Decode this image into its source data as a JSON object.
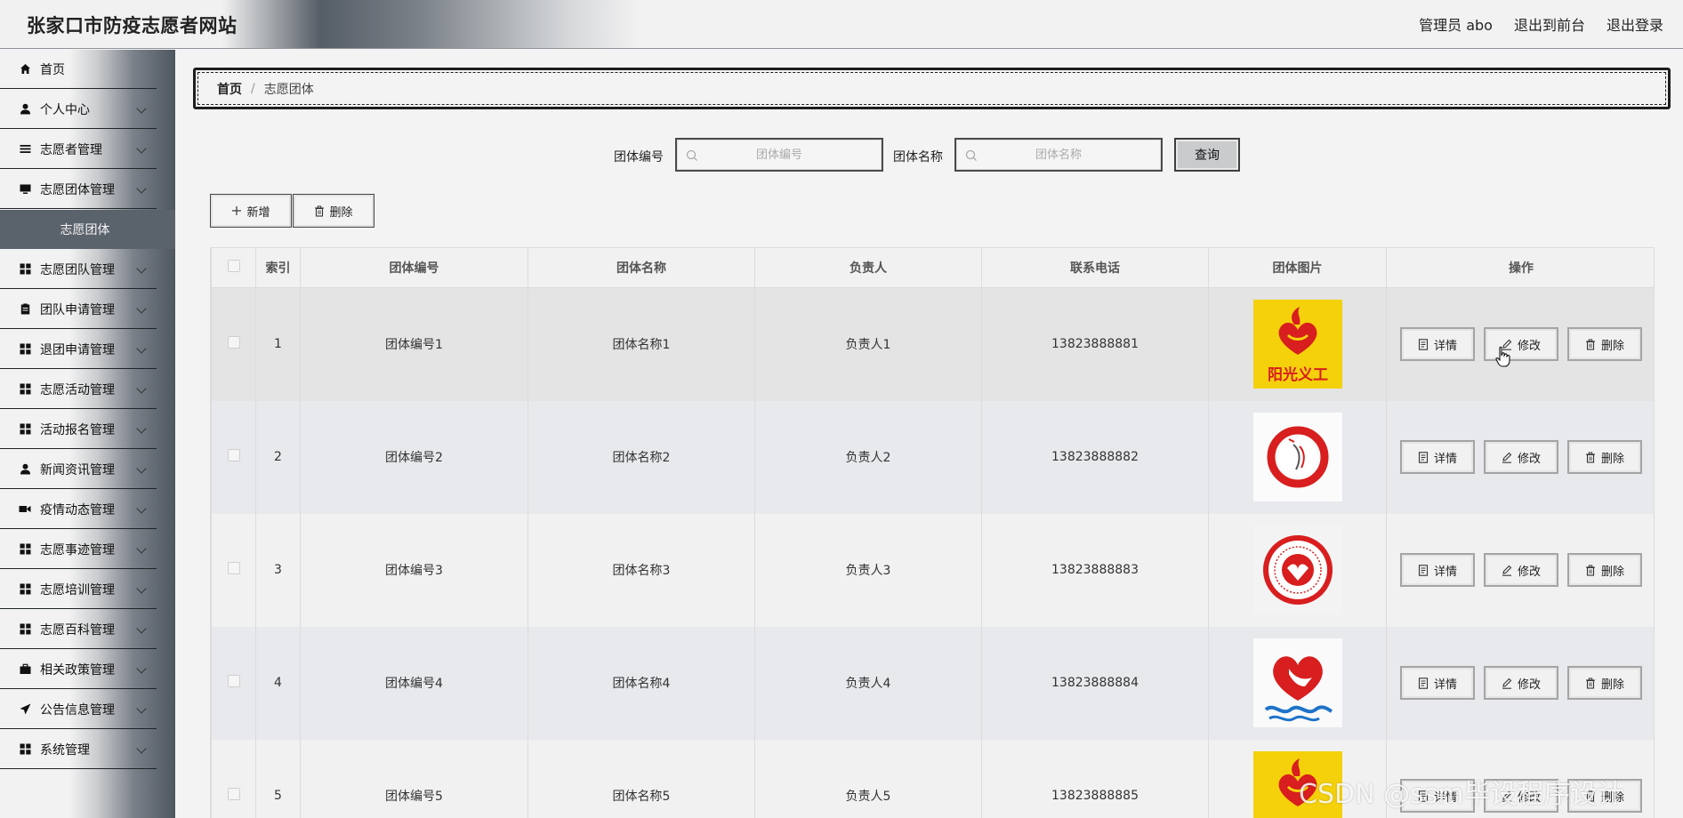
{
  "header": {
    "site_title": "张家口市防疫志愿者网站",
    "admin_label": "管理员 abo",
    "to_front": "退出到前台",
    "logout": "退出登录"
  },
  "sidebar": {
    "items": [
      {
        "label": "首页",
        "icon": "home-icon",
        "has_children": false
      },
      {
        "label": "个人中心",
        "icon": "user-icon",
        "has_children": true
      },
      {
        "label": "志愿者管理",
        "icon": "list-icon",
        "has_children": true
      },
      {
        "label": "志愿团体管理",
        "icon": "monitor-icon",
        "has_children": true
      },
      {
        "label": "志愿团队管理",
        "icon": "grid-icon",
        "has_children": true
      },
      {
        "label": "团队申请管理",
        "icon": "clipboard-icon",
        "has_children": true
      },
      {
        "label": "退团申请管理",
        "icon": "grid-icon",
        "has_children": true
      },
      {
        "label": "志愿活动管理",
        "icon": "grid-icon",
        "has_children": true
      },
      {
        "label": "活动报名管理",
        "icon": "grid-icon",
        "has_children": true
      },
      {
        "label": "新闻资讯管理",
        "icon": "user-icon",
        "has_children": true
      },
      {
        "label": "疫情动态管理",
        "icon": "video-icon",
        "has_children": true
      },
      {
        "label": "志愿事迹管理",
        "icon": "grid-icon",
        "has_children": true
      },
      {
        "label": "志愿培训管理",
        "icon": "grid-icon",
        "has_children": true
      },
      {
        "label": "志愿百科管理",
        "icon": "grid-icon",
        "has_children": true
      },
      {
        "label": "相关政策管理",
        "icon": "briefcase-icon",
        "has_children": true
      },
      {
        "label": "公告信息管理",
        "icon": "send-icon",
        "has_children": true
      },
      {
        "label": "系统管理",
        "icon": "grid-icon",
        "has_children": true
      }
    ],
    "active_submenu": "志愿团体"
  },
  "breadcrumb": {
    "home": "首页",
    "separator": "/",
    "current": "志愿团体"
  },
  "search": {
    "code_label": "团体编号",
    "code_placeholder": "团体编号",
    "name_label": "团体名称",
    "name_placeholder": "团体名称",
    "query_button": "查询"
  },
  "toolbar": {
    "add_label": "新增",
    "delete_label": "删除"
  },
  "table": {
    "columns": [
      "索引",
      "团体编号",
      "团体名称",
      "负责人",
      "联系电话",
      "团体图片",
      "操作"
    ],
    "rows": [
      {
        "index": "1",
        "code": "团体编号1",
        "name": "团体名称1",
        "leader": "负责人1",
        "phone": "13823888881",
        "image": "sunshine-volunteer-logo"
      },
      {
        "index": "2",
        "code": "团体编号2",
        "name": "团体名称2",
        "leader": "负责人2",
        "phone": "13823888882",
        "image": "red-circle-volunteer-logo"
      },
      {
        "index": "3",
        "code": "团体编号3",
        "name": "团体名称3",
        "leader": "负责人3",
        "phone": "13823888883",
        "image": "red-seal-hands-logo"
      },
      {
        "index": "4",
        "code": "团体编号4",
        "name": "团体名称4",
        "leader": "负责人4",
        "phone": "13823888884",
        "image": "heart-hand-wave-logo"
      },
      {
        "index": "5",
        "code": "团体编号5",
        "name": "团体名称5",
        "leader": "负责人5",
        "phone": "13823888885",
        "image": "sunshine-volunteer-logo"
      }
    ],
    "ops": {
      "detail": "详情",
      "edit": "修改",
      "delete": "删除"
    },
    "logo_text": "阳光义工"
  },
  "watermark": "CSDN @ssm毕设程序设计",
  "colors": {
    "active_menu_bg": "#5a626c",
    "logo_yellow": "#f4d10b",
    "logo_red": "#d81e1e"
  }
}
